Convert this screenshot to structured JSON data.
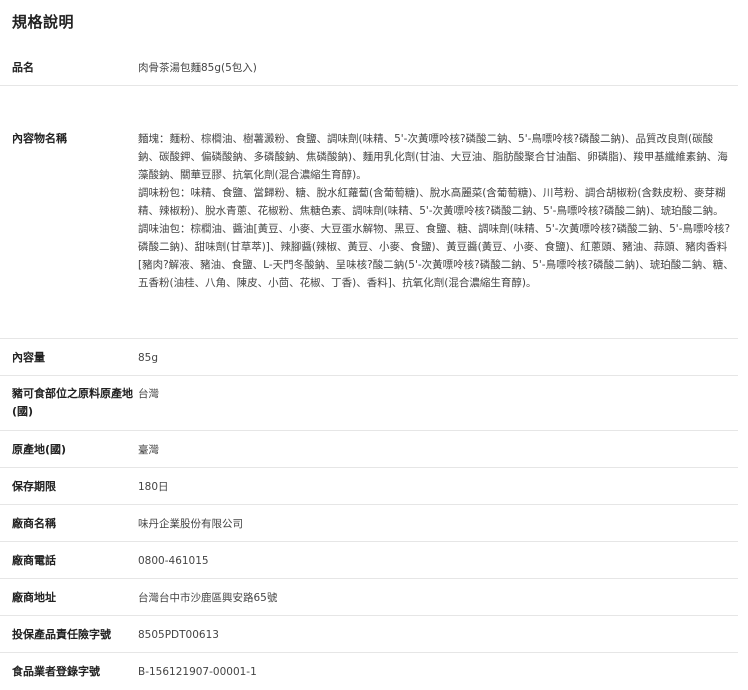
{
  "section_title": "規格說明",
  "rows": [
    {
      "label": "品名",
      "value": "肉骨茶湯包麵85g(5包入)"
    },
    {
      "label": "內容物名稱",
      "paragraphs": [
        "麵塊：麵粉、棕櫚油、樹薯澱粉、食鹽、調味劑(味精、5'-次黃嘌呤核?磷酸二鈉、5'-鳥嘌呤核?磷酸二鈉)、品質改良劑(碳酸鈉、碳酸鉀、偏磷酸鈉、多磷酸鈉、焦磷酸鈉)、麵用乳化劑(甘油、大豆油、脂肪酸聚合甘油酯、卵磷脂)、羧甲基纖維素鈉、海藻酸鈉、關華豆膠、抗氧化劑(混合濃縮生育醇)。",
        "調味粉包：味精、食鹽、當歸粉、糖、脫水紅蘿蔔(含葡萄糖)、脫水高麗菜(含葡萄糖)、川芎粉、調合胡椒粉(含麩皮粉、麥芽糊精、辣椒粉)、脫水青蔥、花椒粉、焦糖色素、調味劑(味精、5'-次黃嘌呤核?磷酸二鈉、5'-鳥嘌呤核?磷酸二鈉)、琥珀酸二鈉。",
        "調味油包：棕櫚油、醬油[黃豆、小麥、大豆蛋水解物、黑豆、食鹽、糖、調味劑(味精、5'-次黃嘌呤核?磷酸二鈉、5'-鳥嘌呤核?磷酸二鈉)、甜味劑(甘草萃)]、辣腳醬(辣椒、黃豆、小麥、食鹽)、黃豆醬(黃豆、小麥、食鹽)、紅蔥頭、豬油、蒜頭、豬肉香料[豬肉?解液、豬油、食鹽、L-天門冬酸鈉、呈味核?酸二鈉(5'-次黃嘌呤核?磷酸二鈉、5'-鳥嘌呤核?磷酸二鈉)、琥珀酸二鈉、糖、五香粉(油桂、八角、陳皮、小茴、花椒、丁香)、香料]、抗氧化劑(混合濃縮生育醇)。"
      ]
    },
    {
      "label": "內容量",
      "value": "85g"
    },
    {
      "label": "豬可食部位之原料原產地(國)",
      "value": "台灣"
    },
    {
      "label": "原產地(國)",
      "value": "臺灣"
    },
    {
      "label": "保存期限",
      "value": "180日"
    },
    {
      "label": "廠商名稱",
      "value": "味丹企業股份有限公司"
    },
    {
      "label": "廠商電話",
      "value": "0800-461015"
    },
    {
      "label": "廠商地址",
      "value": "台灣台中市沙鹿區興安路65號"
    },
    {
      "label": "投保產品責任險字號",
      "value": "8505PDT00613"
    },
    {
      "label": "食品業者登錄字號",
      "value": "B-156121907-00001-1"
    }
  ]
}
